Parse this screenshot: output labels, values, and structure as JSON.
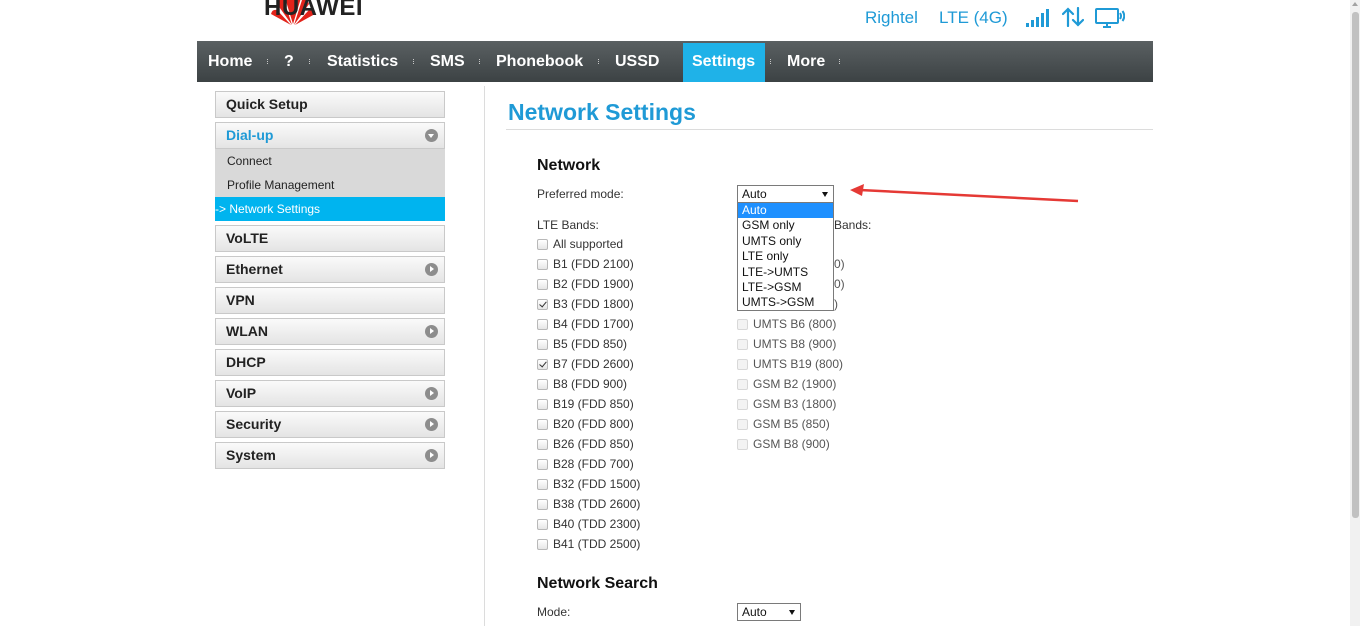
{
  "header": {
    "brand": "HUAWEI",
    "operator": "Rightel",
    "network_type": "LTE (4G)",
    "icons": [
      "huawei-logo",
      "signal-strength-icon",
      "data-transfer-icon",
      "computer-connection-icon"
    ]
  },
  "nav": {
    "items": [
      "Home",
      "?",
      "Statistics",
      "SMS",
      "Phonebook",
      "USSD",
      "Settings",
      "More"
    ],
    "active": "Settings"
  },
  "sidebar": {
    "quick_setup": "Quick Setup",
    "dialup": "Dial-up",
    "sub_items": [
      "Connect",
      "Profile Management",
      "Network Settings"
    ],
    "active_sub_prefix": "-> ",
    "volte": "VoLTE",
    "ethernet": "Ethernet",
    "vpn": "VPN",
    "wlan": "WLAN",
    "dhcp": "DHCP",
    "voip": "VoIP",
    "security": "Security",
    "system": "System"
  },
  "main": {
    "title": "Network Settings",
    "network_heading": "Network",
    "preferred_mode_label": "Preferred mode:",
    "preferred_mode_value": "Auto",
    "dropdown_options": [
      "Auto",
      "GSM only",
      "UMTS only",
      "LTE only",
      "LTE->UMTS",
      "LTE->GSM",
      "UMTS->GSM"
    ],
    "lte_bands_label": "LTE Bands:",
    "other_bands_label_visible": "Bands:",
    "lte_bands": [
      {
        "label": "All supported",
        "checked": false
      },
      {
        "label": "B1 (FDD 2100)",
        "checked": false
      },
      {
        "label": "B2 (FDD 1900)",
        "checked": false
      },
      {
        "label": "B3 (FDD 1800)",
        "checked": true
      },
      {
        "label": "B4 (FDD 1700)",
        "checked": false
      },
      {
        "label": "B5 (FDD 850)",
        "checked": false
      },
      {
        "label": "B7 (FDD 2600)",
        "checked": true
      },
      {
        "label": "B8 (FDD 900)",
        "checked": false
      },
      {
        "label": "B19 (FDD 850)",
        "checked": false
      },
      {
        "label": "B20 (FDD 800)",
        "checked": false
      },
      {
        "label": "B26 (FDD 850)",
        "checked": false
      },
      {
        "label": "B28 (FDD 700)",
        "checked": false
      },
      {
        "label": "B32 (FDD 1500)",
        "checked": false
      },
      {
        "label": "B38 (TDD 2600)",
        "checked": false
      },
      {
        "label": "B40 (TDD 2300)",
        "checked": false
      },
      {
        "label": "B41 (TDD 2500)",
        "checked": false
      }
    ],
    "partial_band_fragments": [
      "0)",
      "0)",
      ")"
    ],
    "other_bands": [
      {
        "label": "UMTS B6 (800)",
        "checked": false
      },
      {
        "label": "UMTS B8 (900)",
        "checked": false
      },
      {
        "label": "UMTS B19 (800)",
        "checked": false
      },
      {
        "label": "GSM B2 (1900)",
        "checked": false
      },
      {
        "label": "GSM B3 (1800)",
        "checked": false
      },
      {
        "label": "GSM B5 (850)",
        "checked": false
      },
      {
        "label": "GSM B8 (900)",
        "checked": false
      }
    ],
    "network_search_heading": "Network Search",
    "mode_label": "Mode:",
    "mode_value": "Auto"
  },
  "colors": {
    "accent": "#1f9ad6",
    "nav_active": "#1fb2e8",
    "sub_active": "#00b4ef",
    "annotation_arrow": "#e53935"
  }
}
